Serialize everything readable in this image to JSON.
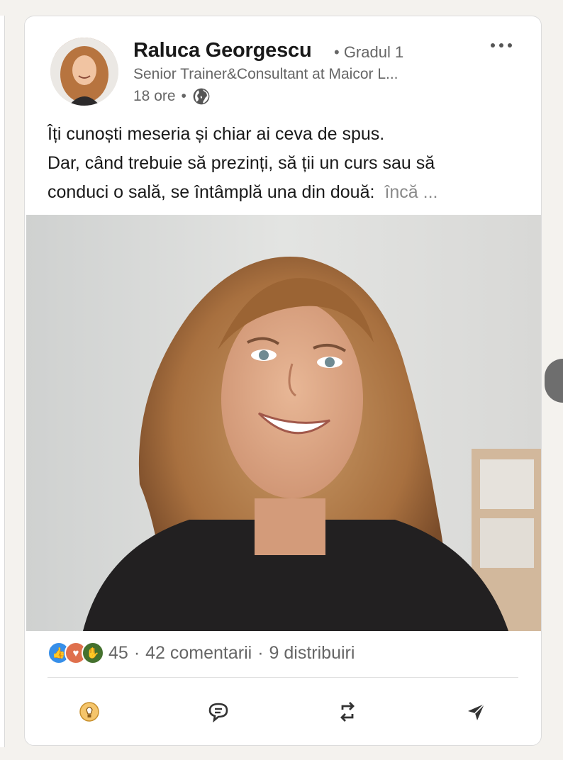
{
  "post": {
    "author": {
      "name": "Raluca Georgescu",
      "degree": "• Gradul 1",
      "headline": "Senior Trainer&Consultant at Maicor L...",
      "time": "18 ore",
      "visibility_icon": "globe-icon"
    },
    "text_lines": [
      "Îți cunoști meseria și chiar ai ceva de spus.",
      "Dar, când trebuie să prezinți, să ții un curs sau să",
      "conduci o sală, se întâmplă una din două:"
    ],
    "see_more": "încă ...",
    "image_subject": "portrait-photo",
    "stats": {
      "reactions": "45",
      "comments": "42 comentarii",
      "shares": "9 distribuiri"
    },
    "reaction_icons": [
      "like-icon",
      "love-icon",
      "support-icon"
    ],
    "actions": [
      "like-icon",
      "comment-icon",
      "repost-icon",
      "send-icon"
    ],
    "colors": {
      "like": "#378fe9",
      "love": "#df704d",
      "support": "#44712e",
      "muted_text": "#666666"
    }
  }
}
